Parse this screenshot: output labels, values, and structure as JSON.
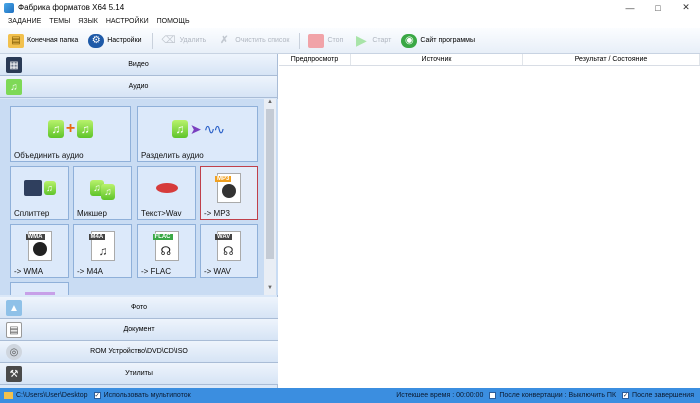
{
  "window": {
    "title": "Фабрика форматов X64 5.14"
  },
  "menu": [
    "ЗАДАНИЕ",
    "ТЕМЫ",
    "ЯЗЫК",
    "НАСТРОЙКИ",
    "ПОМОЩЬ"
  ],
  "toolbar": {
    "output_folder": "Конечная папка",
    "settings": "Настройки",
    "delete": "Удалить",
    "clear_list": "Очистить список",
    "stop": "Стоп",
    "start": "Старт",
    "website": "Сайт программы"
  },
  "categories_top": {
    "video": "Видео",
    "audio": "Аудио"
  },
  "tiles": {
    "join": "Объединить аудио",
    "split": "Разделить аудио",
    "splitter": "Сплиттер",
    "mixer": "Микшер",
    "text_wav": "Текст>Wav",
    "mp3": "-> MP3",
    "wma": "-> WMA",
    "m4a": "-> M4A",
    "flac": "-> FLAC",
    "wav": "-> WAV"
  },
  "badges": {
    "mp3": "MP3",
    "wma": "WMA",
    "m4a": "M4A",
    "flac": "FLAC",
    "wav": "WAV"
  },
  "categories_bottom": {
    "photo": "Фото",
    "document": "Документ",
    "rom": "ROM Устройство\\DVD\\CD\\ISO",
    "utilities": "Утилиты"
  },
  "table": {
    "columns": [
      "Предпросмотр",
      "Источник",
      "Результат / Состояние"
    ]
  },
  "status": {
    "path": "C:\\Users\\User\\Desktop",
    "multithread": "Использовать мультипоток",
    "elapsed_label": "Истекшее время : 00:00:00",
    "after_convert": "После конвертации : Выключить ПК",
    "after_finish": "После завершения"
  },
  "colors": {
    "accent": "#3b8ee0",
    "panel": "#dbe8f8",
    "selected_border": "#c0404a"
  }
}
